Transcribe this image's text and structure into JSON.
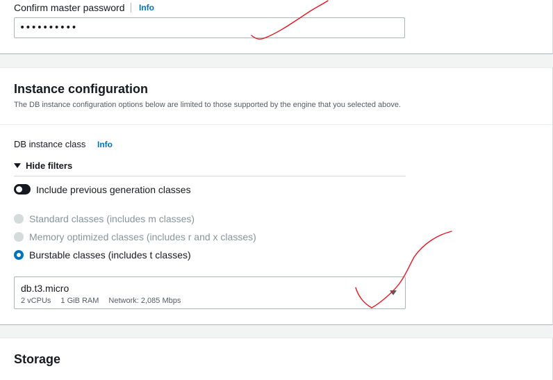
{
  "master_password": {
    "label": "Confirm master password",
    "info": "Info",
    "value": "••••••••••"
  },
  "instance_configuration": {
    "title": "Instance configuration",
    "description": "The DB instance configuration options below are limited to those supported by the engine that you selected above.",
    "db_instance_class": {
      "label": "DB instance class",
      "info": "Info"
    },
    "hide_filters": "Hide filters",
    "include_previous": {
      "label": "Include previous generation classes",
      "enabled": false
    },
    "classes": [
      {
        "label": "Standard classes (includes m classes)",
        "state": "disabled"
      },
      {
        "label": "Memory optimized classes (includes r and x classes)",
        "state": "disabled"
      },
      {
        "label": "Burstable classes (includes t classes)",
        "state": "selected"
      }
    ],
    "selected_instance": {
      "name": "db.t3.micro",
      "vcpus": "2 vCPUs",
      "ram": "1 GiB RAM",
      "network": "Network: 2,085 Mbps"
    }
  },
  "storage": {
    "title": "Storage"
  },
  "colors": {
    "accent": "#0073bb",
    "annotation": "#e8141e"
  }
}
